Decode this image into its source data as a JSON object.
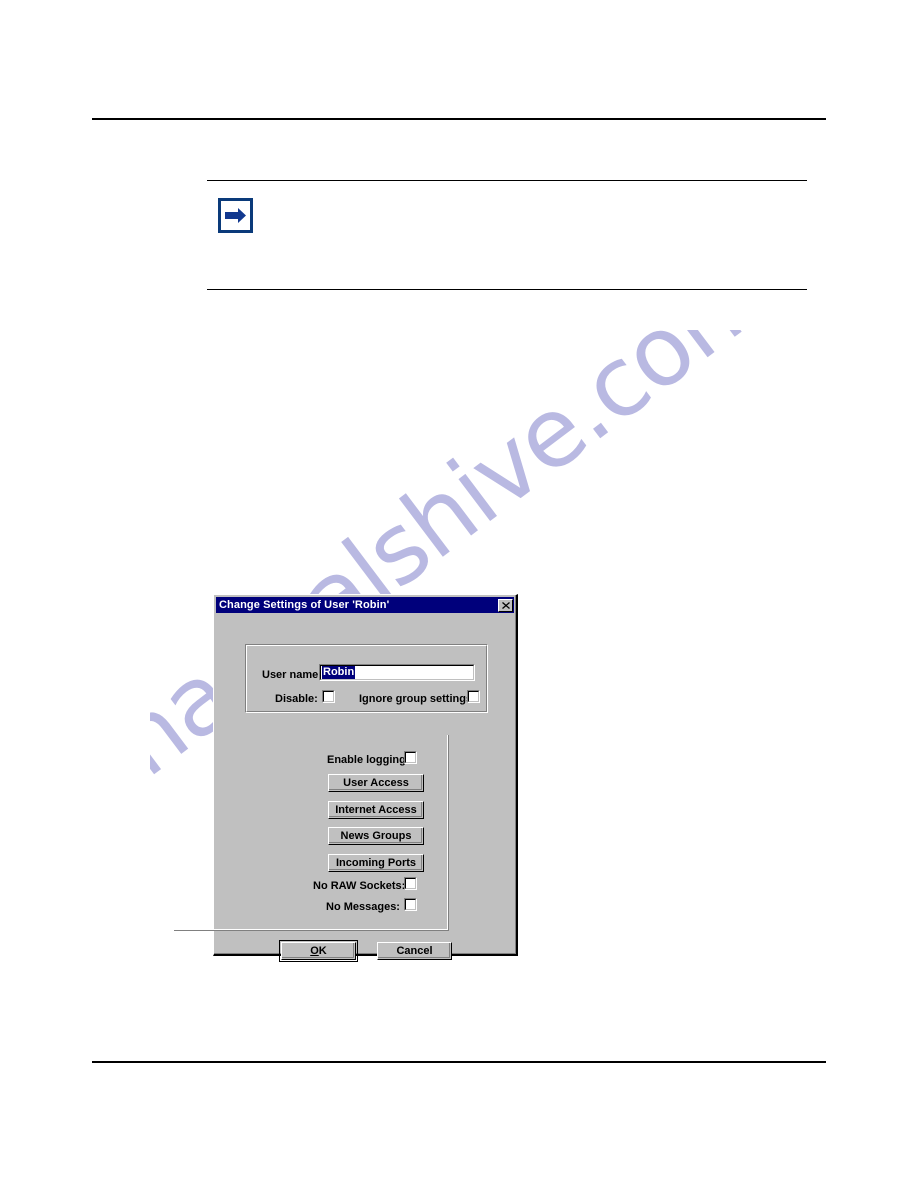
{
  "page": {
    "background": "#ffffff",
    "rules": [
      "top-rule",
      "bottom-rule"
    ]
  },
  "note": {
    "icon": "blue-right-arrow-icon",
    "icon_border_color": "#0a3a7a",
    "icon_fill_color": "#11388f"
  },
  "watermark": {
    "text": "manualshive.com",
    "color": "#b9b9e2"
  },
  "dialog": {
    "title": "Change Settings of User 'Robin'",
    "titlebar_color": "#00007b",
    "face_color": "#c0c0c0",
    "close_button_label": "x",
    "user_group": {
      "username_label": "User name:",
      "username_value": "Robin",
      "username_selected": true,
      "disable_label": "Disable:",
      "disable_checked": false,
      "ignore_group_label": "Ignore group settings:",
      "ignore_group_checked": false
    },
    "options_group": {
      "enable_logging_label": "Enable logging:",
      "enable_logging_checked": false,
      "buttons": [
        {
          "label": "User Access"
        },
        {
          "label": "Internet Access"
        },
        {
          "label": "News Groups"
        },
        {
          "label": "Incoming Ports"
        }
      ],
      "no_raw_sockets_label": "No RAW Sockets:",
      "no_raw_sockets_checked": false,
      "no_messages_label": "No Messages:",
      "no_messages_checked": false
    },
    "footer": {
      "ok_label": "OK",
      "ok_accelerator": "O",
      "cancel_label": "Cancel",
      "default_button": "OK"
    }
  }
}
